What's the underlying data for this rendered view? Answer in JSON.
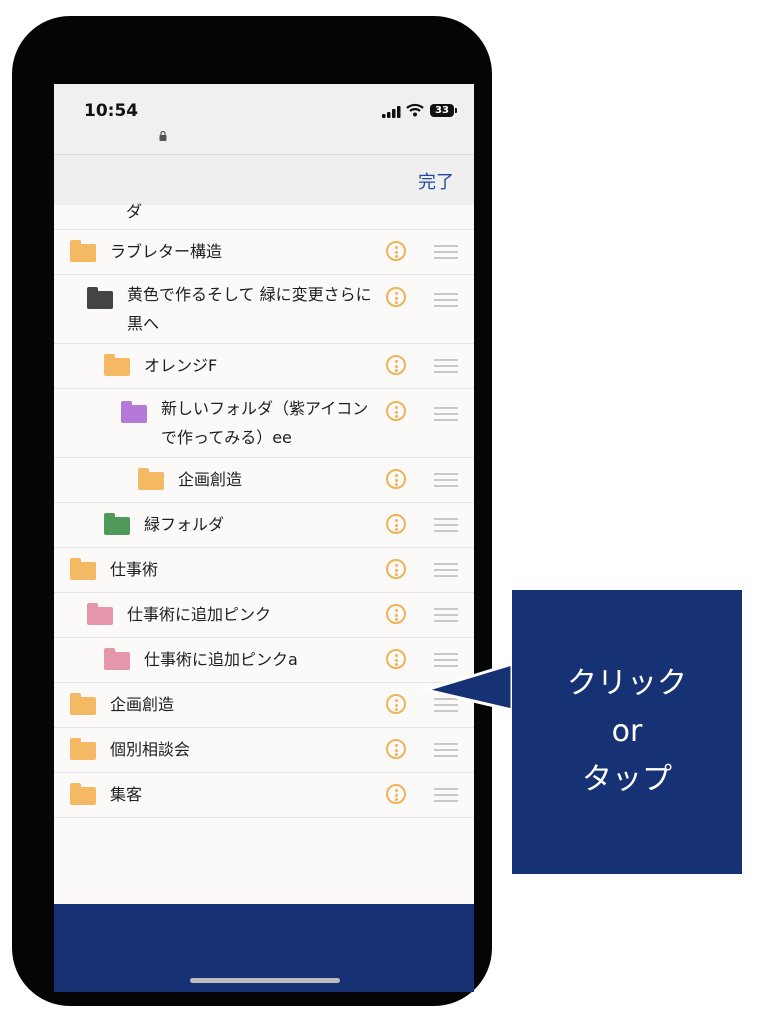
{
  "status": {
    "time": "10:54",
    "battery": "33"
  },
  "toolbar": {
    "done_label": "完了"
  },
  "partial_item": "ダ",
  "folders": [
    {
      "label": "ラブレター構造",
      "indent": 0,
      "color": "#f5b964",
      "tall": false
    },
    {
      "label": "黄色で作るそして 緑に変更さらに黒へ",
      "indent": 1,
      "color": "#444444",
      "tall": true
    },
    {
      "label": "オレンジF",
      "indent": 2,
      "color": "#f5b964",
      "tall": false
    },
    {
      "label": "新しいフォルダ（紫アイコンで作ってみる）ee",
      "indent": 3,
      "color": "#b57ad8",
      "tall": true
    },
    {
      "label": "企画創造",
      "indent": 4,
      "color": "#f5b964",
      "tall": false
    },
    {
      "label": "緑フォルダ",
      "indent": 2,
      "color": "#4f9a5a",
      "tall": false
    },
    {
      "label": "仕事術",
      "indent": 0,
      "color": "#f5b964",
      "tall": false
    },
    {
      "label": "仕事術に追加ピンク",
      "indent": 1,
      "color": "#e596ab",
      "tall": false
    },
    {
      "label": "仕事術に追加ピンクa",
      "indent": 2,
      "color": "#e596ab",
      "tall": false
    },
    {
      "label": "企画創造",
      "indent": 0,
      "color": "#f5b964",
      "tall": false
    },
    {
      "label": "個別相談会",
      "indent": 0,
      "color": "#f5b964",
      "tall": false
    },
    {
      "label": "集客",
      "indent": 0,
      "color": "#f5b964",
      "tall": false
    }
  ],
  "callout": {
    "line1": "クリック",
    "line2": "or",
    "line3": "タップ"
  },
  "colors": {
    "accent": "#163274",
    "more_icon": "#f0b35a",
    "done_text": "#234a9a"
  }
}
